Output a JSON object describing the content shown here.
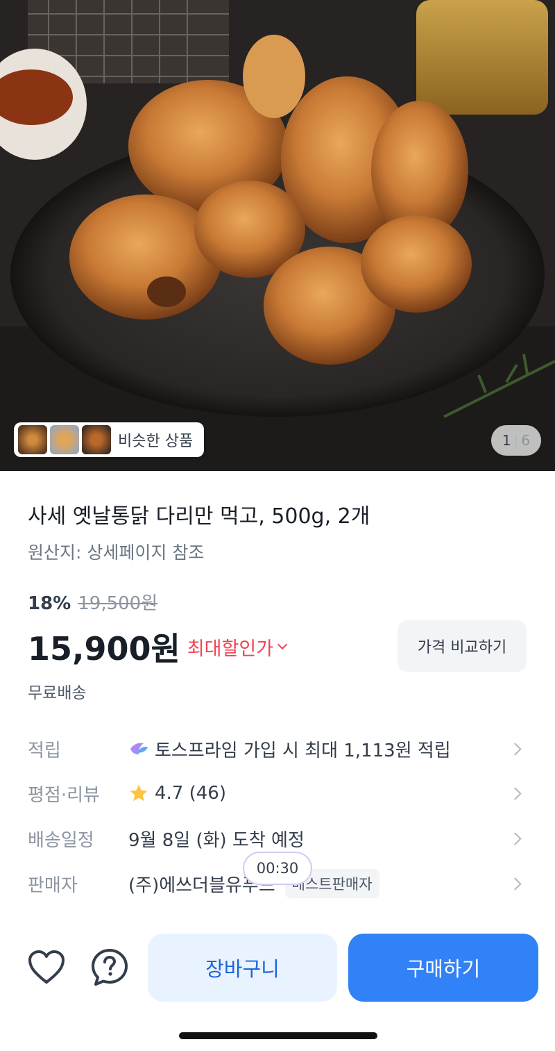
{
  "hero": {
    "similar_label": "비슷한 상품",
    "pager_current": "1",
    "pager_sep": "|",
    "pager_total": "6"
  },
  "product": {
    "title": "사세 옛날통닭 다리만 먹고, 500g, 2개",
    "origin": "원산지: 상세페이지 참조",
    "discount_rate": "18%",
    "original_price": "19,500원",
    "price": "15,900원",
    "max_discount_label": "최대할인가",
    "compare_label": "가격 비교하기",
    "shipping": "무료배송"
  },
  "info": {
    "points_label": "적립",
    "points_value": "토스프라임 가입 시 최대 1,113원 적립",
    "rating_label": "평점·리뷰",
    "rating_value": "4.7 (46)",
    "delivery_label": "배송일정",
    "delivery_value": "9월 8일 (화) 도착 예정",
    "seller_label": "판매자",
    "seller_value": "(주)에쓰더블유푸드",
    "seller_badge": "베스트판매자"
  },
  "overlay": {
    "timer": "00:30"
  },
  "actions": {
    "cart": "장바구니",
    "buy": "구매하기"
  },
  "colors": {
    "accent": "#3182f6",
    "discount_red": "#f04452",
    "star": "#ffc342"
  }
}
